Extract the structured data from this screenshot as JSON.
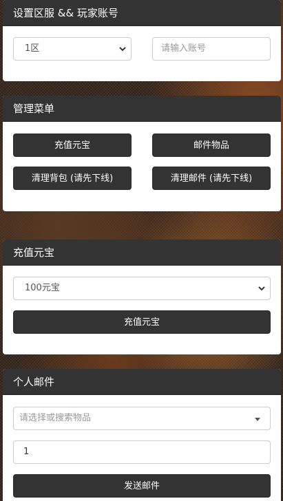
{
  "server_panel": {
    "title": "设置区服 && 玩家账号",
    "server_select": "1区",
    "account_placeholder": "请输入账号"
  },
  "menu_panel": {
    "title": "管理菜单",
    "buttons": [
      "充值元宝",
      "邮件物品",
      "清理背包 (请先下线)",
      "清理邮件 (请先下线)"
    ]
  },
  "recharge_panel": {
    "title": "充值元宝",
    "amount_select": "100元宝",
    "submit_label": "充值元宝"
  },
  "mail_panel": {
    "title": "个人邮件",
    "item_placeholder": "请选择或搜索物品",
    "quantity_value": "1",
    "send_label": "发送邮件"
  },
  "icons": {
    "select_arrow": "chevron-down-icon",
    "combo_arrow": "caret-down-icon"
  }
}
